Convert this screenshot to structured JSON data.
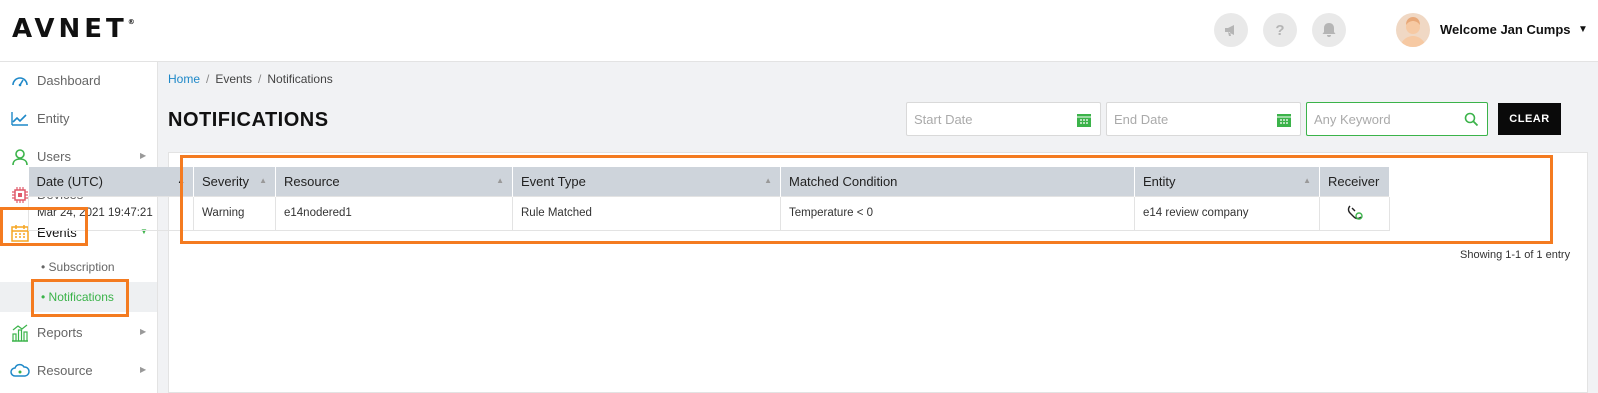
{
  "header": {
    "logo": "AVNET",
    "logo_mark": "®",
    "icons": [
      "megaphone-icon",
      "help-icon",
      "bell-icon"
    ],
    "help_glyph": "?",
    "welcome": "Welcome Jan Cumps",
    "caret": "▼"
  },
  "sidebar": {
    "items": [
      {
        "label": "Dashboard",
        "icon": "dashboard-icon"
      },
      {
        "label": "Entity",
        "icon": "chart-line-icon"
      },
      {
        "label": "Users",
        "icon": "user-icon"
      },
      {
        "label": "Devices",
        "icon": "chip-icon"
      },
      {
        "label": "Events",
        "icon": "calendar-icon"
      },
      {
        "label": "Reports",
        "icon": "bar-chart-icon"
      },
      {
        "label": "Resource",
        "icon": "cloud-icon"
      }
    ],
    "sub_items": [
      {
        "label": "• Subscription"
      },
      {
        "label": "• Notifications"
      }
    ],
    "arrow_right": "▶",
    "arrow_down": "▼"
  },
  "breadcrumb": {
    "home": "Home",
    "sep": "/",
    "events": "Events",
    "current": "Notifications"
  },
  "page_title": "NOTIFICATIONS",
  "filters": {
    "start_placeholder": "Start Date",
    "end_placeholder": "End Date",
    "keyword_placeholder": "Any Keyword",
    "clear_label": "CLEAR"
  },
  "table": {
    "columns": [
      "Date (UTC)",
      "Severity",
      "Resource",
      "Event Type",
      "Matched Condition",
      "Entity",
      "Receiver"
    ],
    "sort_up": "▲",
    "sort_both": "▲",
    "rows": [
      [
        "Mar 24, 2021 19:47:21",
        "Warning",
        "e14nodered1",
        "Rule Matched",
        "Temperature < 0",
        "e14 review company",
        ""
      ]
    ]
  },
  "showing": "Showing 1-1 of 1 entry",
  "colors": {
    "accent": "#3bb34a",
    "highlight": "#f47b20",
    "link": "#1e88c8"
  }
}
